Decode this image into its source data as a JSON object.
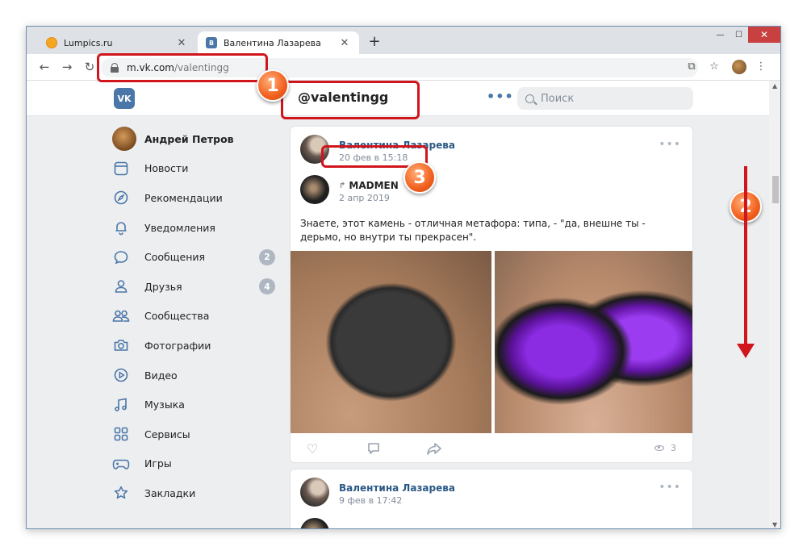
{
  "browser": {
    "tabs": [
      {
        "label": "Lumpics.ru",
        "close": "✕"
      },
      {
        "label": "Валентина Лазарева",
        "close": "✕"
      }
    ],
    "new_tab": "+",
    "url_host": "m.vk.com",
    "url_path": "/valentingg"
  },
  "vk": {
    "logo": "VK",
    "page_title": "@valentingg",
    "search_placeholder": "Поиск"
  },
  "sidebar": {
    "user_name": "Андрей Петров",
    "items": [
      {
        "label": "Новости",
        "icon": "news-icon"
      },
      {
        "label": "Рекомендации",
        "icon": "compass-icon"
      },
      {
        "label": "Уведомления",
        "icon": "bell-icon"
      },
      {
        "label": "Сообщения",
        "icon": "chat-icon",
        "badge": "2"
      },
      {
        "label": "Друзья",
        "icon": "person-icon",
        "badge": "4"
      },
      {
        "label": "Сообщества",
        "icon": "group-icon"
      },
      {
        "label": "Фотографии",
        "icon": "camera-icon"
      },
      {
        "label": "Видео",
        "icon": "play-icon"
      },
      {
        "label": "Музыка",
        "icon": "music-icon"
      },
      {
        "label": "Сервисы",
        "icon": "grid-icon"
      },
      {
        "label": "Игры",
        "icon": "gamepad-icon"
      },
      {
        "label": "Закладки",
        "icon": "star-icon"
      }
    ]
  },
  "post1": {
    "author": "Валентина Лазарева",
    "date": "20 фев в 15:18",
    "repost_author": "MADMEN",
    "repost_date": "2 апр 2019",
    "text": "Знаете, этот камень - отличная метафора: типа, - \"да, внешне ты - дерьмо, но внутри ты прекрасен\".",
    "views": "3"
  },
  "post2": {
    "author": "Валентина Лазарева",
    "date": "9 фев в 17:42"
  },
  "annotations": {
    "n1": "1",
    "n2": "2",
    "n3": "3",
    "color": "#d0161c"
  }
}
